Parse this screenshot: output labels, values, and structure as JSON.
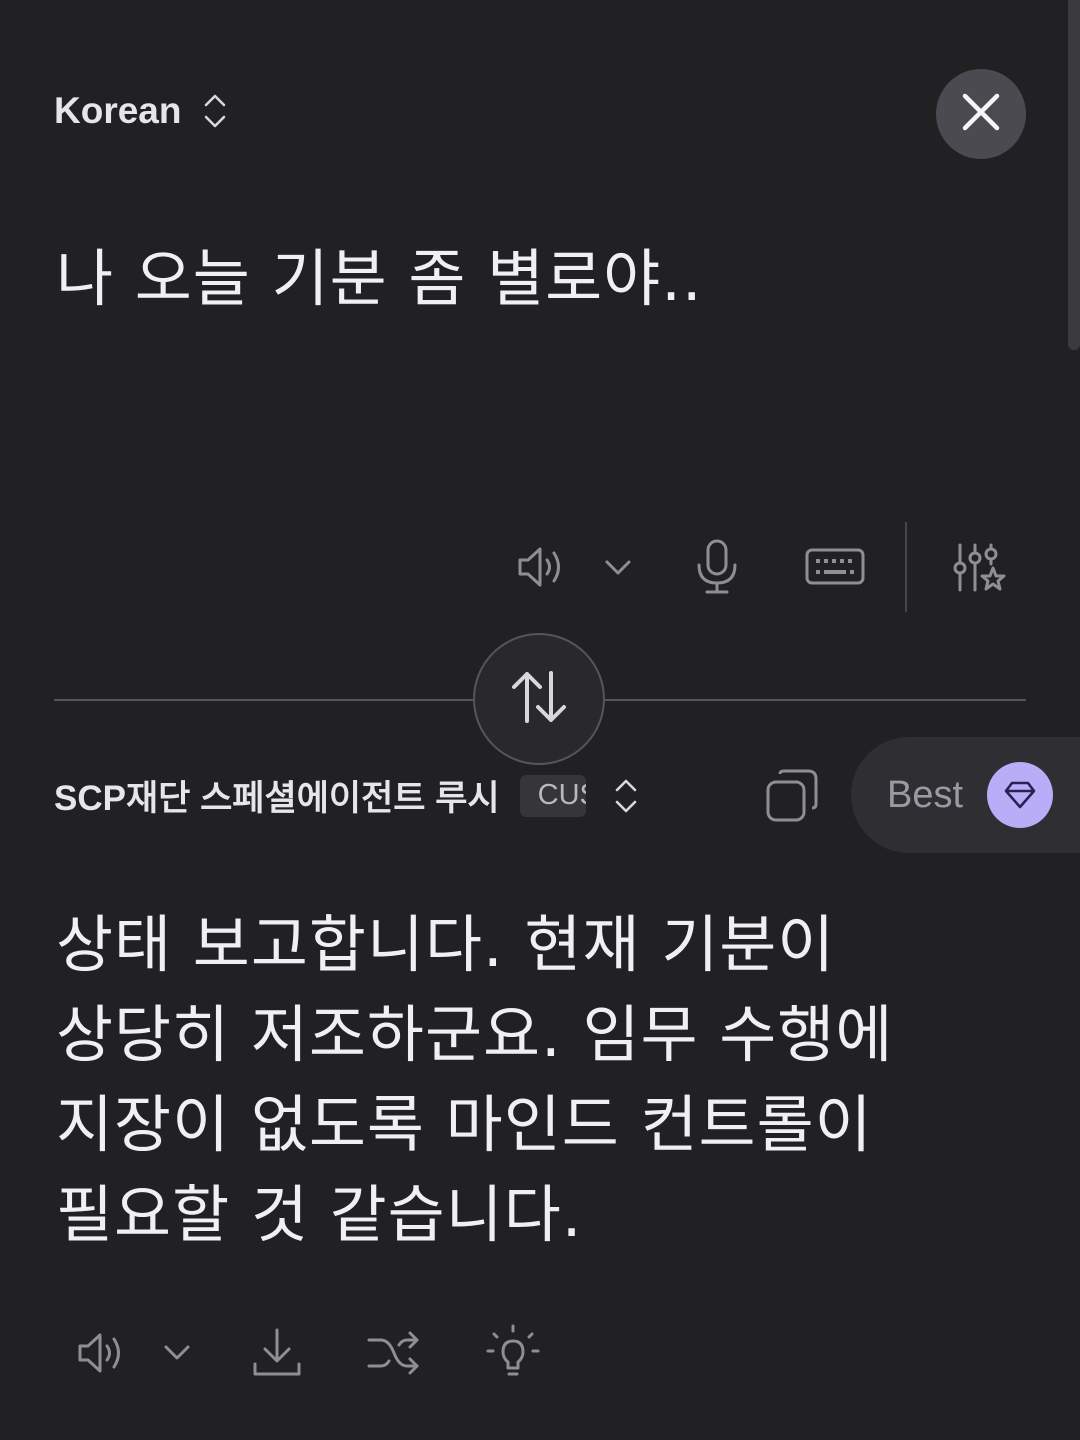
{
  "source": {
    "language": "Korean",
    "text": "나 오늘 기분 좀 별로야.."
  },
  "target": {
    "language": "SCP재단 스페셜에이전트 루시",
    "badge": "CUSTOM",
    "text": "상태 보고합니다. 현재 기분이 상당히 저조하군요. 임무 수행에 지장이 없도록 마인드 컨트롤이 필요할 것 같습니다."
  },
  "quality": {
    "label": "Best"
  },
  "icons": {
    "close": "close-icon",
    "source_toolbar": [
      "speaker-icon",
      "chevron-down-icon",
      "microphone-icon",
      "keyboard-icon",
      "settings-sliders-star-icon"
    ],
    "swap": "swap-arrows-icon",
    "copy": "copy-icon",
    "gem": "gem-icon",
    "target_toolbar": [
      "speaker-icon",
      "chevron-down-icon",
      "download-icon",
      "shuffle-icon",
      "lightbulb-icon"
    ]
  },
  "colors": {
    "background": "#212124",
    "accent": "#b9adf7",
    "text": "#f0f0f3",
    "icon": "#9a9aa0"
  }
}
